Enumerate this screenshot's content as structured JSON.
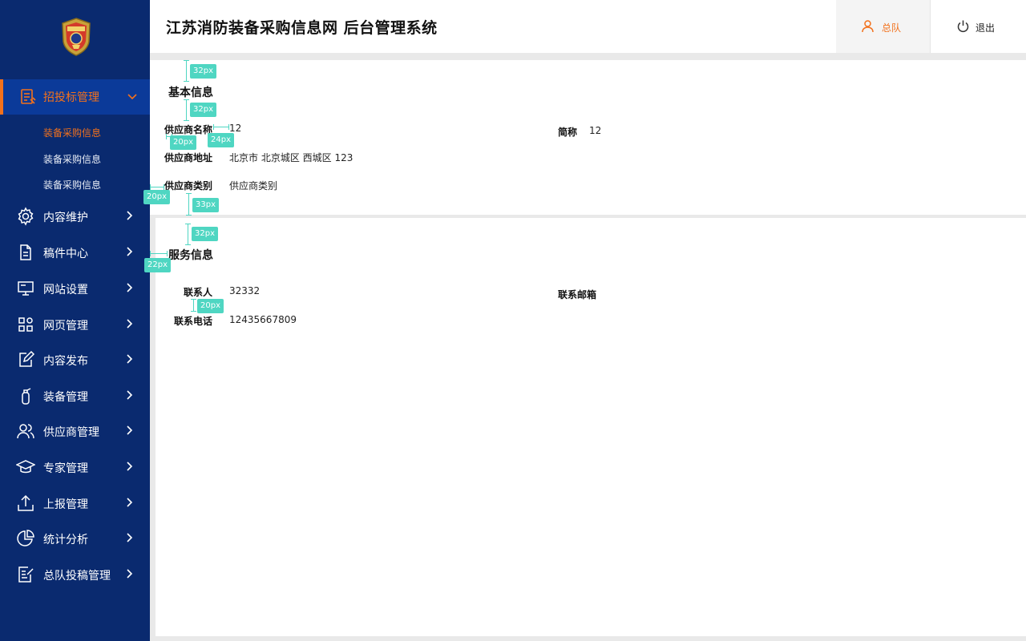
{
  "header": {
    "title": "江苏消防装备采购信息网  后台管理系统",
    "user_label": "总队",
    "logout_label": "退出"
  },
  "sidebar": {
    "active_group": {
      "label": "招投标管理",
      "subitems": [
        "装备采购信息",
        "装备采购信息",
        "装备采购信息"
      ]
    },
    "items": [
      {
        "label": "内容维护",
        "icon": "gear-icon"
      },
      {
        "label": "稿件中心",
        "icon": "document-icon"
      },
      {
        "label": "网站设置",
        "icon": "monitor-icon"
      },
      {
        "label": "网页管理",
        "icon": "grid-icon"
      },
      {
        "label": "内容发布",
        "icon": "edit-icon"
      },
      {
        "label": "装备管理",
        "icon": "extinguisher-icon"
      },
      {
        "label": "供应商管理",
        "icon": "users-icon"
      },
      {
        "label": "专家管理",
        "icon": "graduation-cap-icon"
      },
      {
        "label": "上报管理",
        "icon": "upload-icon"
      },
      {
        "label": "统计分析",
        "icon": "pie-chart-icon"
      },
      {
        "label": "总队投稿管理",
        "icon": "submission-icon"
      }
    ]
  },
  "basic": {
    "section_title": "基本信息",
    "name_label": "供应商名称",
    "name_value": "12",
    "short_label": "简称",
    "short_value": "12",
    "address_label": "供应商地址",
    "address_value": "北京市 北京城区 西城区 123",
    "type_label": "供应商类别",
    "type_value": "供应商类别"
  },
  "service": {
    "section_title": "服务信息",
    "contact_label": "联系人",
    "contact_value": "32332",
    "email_label": "联系邮箱",
    "phone_label": "联系电话",
    "phone_value": "12435667809"
  },
  "annotations": {
    "m1": "32px",
    "m2": "32px",
    "m3": "20px",
    "m4": "24px",
    "m5": "20px",
    "m6": "33px",
    "m7": "32px",
    "m8": "22px",
    "m9": "20px"
  },
  "colors": {
    "sidebar_bg": "#0a2a6f",
    "accent": "#f2711c",
    "annotation": "#4fd6c2"
  }
}
